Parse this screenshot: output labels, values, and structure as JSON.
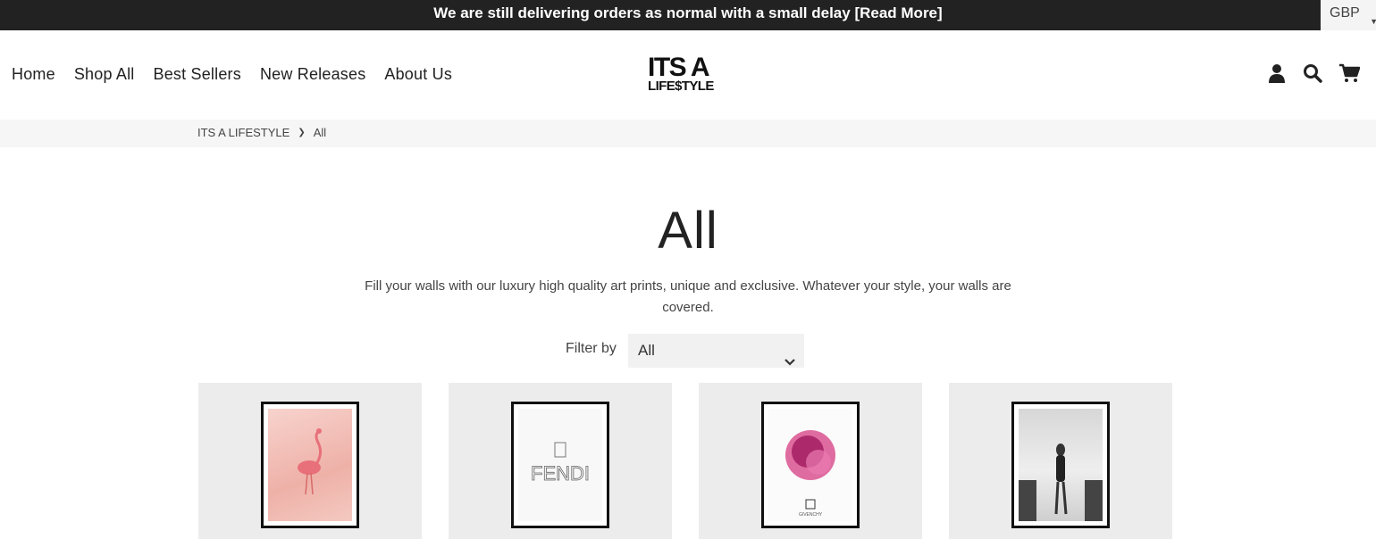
{
  "announcement": {
    "text": "We are still delivering orders as normal with a small delay [Read More]"
  },
  "currency": {
    "value": "GBP"
  },
  "nav": [
    "Home",
    "Shop All",
    "Best Sellers",
    "New Releases",
    "About Us"
  ],
  "logo": {
    "line1": "ITS A",
    "line2": "LIFE$TYLE"
  },
  "header_icons": [
    "account-icon",
    "search-icon",
    "cart-icon"
  ],
  "breadcrumb": {
    "home": "ITS A LIFESTYLE",
    "current": "All"
  },
  "collection": {
    "title": "All",
    "description": "Fill your walls with our luxury high quality art prints, unique and exclusive. Whatever your style, your walls are covered."
  },
  "filter": {
    "label": "Filter by",
    "selected": "All"
  },
  "products": [
    {
      "image": "flamingo-print"
    },
    {
      "image": "fendi-print",
      "art_text": "FENDI"
    },
    {
      "image": "givenchy-lion-print",
      "art_text": "GIVENCHY"
    },
    {
      "image": "woman-beach-print"
    }
  ]
}
